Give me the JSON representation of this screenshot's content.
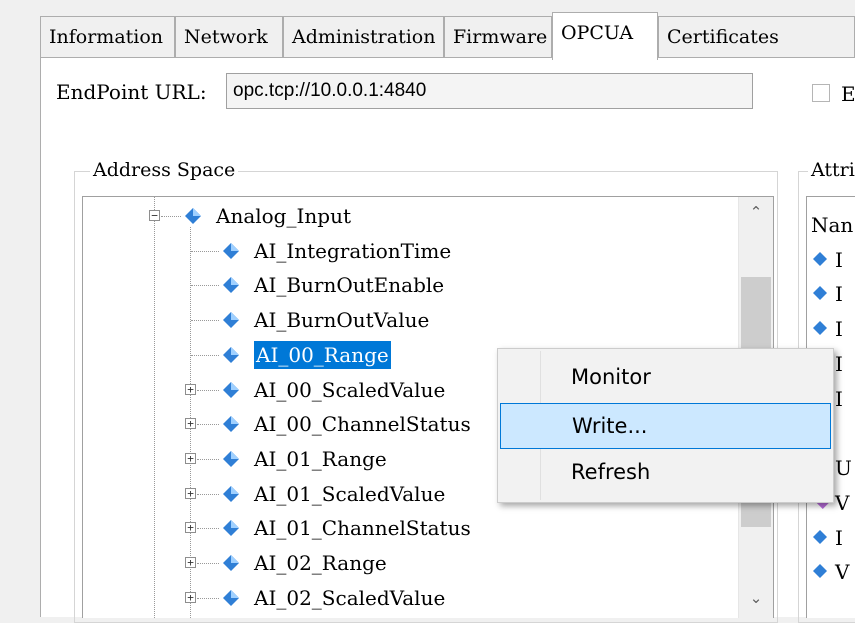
{
  "tabs": [
    {
      "label": "Information",
      "active": false
    },
    {
      "label": "Network",
      "active": false
    },
    {
      "label": "Administration",
      "active": false
    },
    {
      "label": "Firmware",
      "active": false
    },
    {
      "label": "OPCUA",
      "active": true
    },
    {
      "label": "Certificates",
      "active": false
    }
  ],
  "endpoint": {
    "label": "EndPoint URL:",
    "value": "opc.tcp://10.0.0.1:4840"
  },
  "enable_checkbox": {
    "label": "En",
    "checked": false
  },
  "address_space": {
    "title": "Address Space",
    "nodes": [
      {
        "label": "Analog_Input",
        "expander": "−",
        "icon": "variable-icon"
      },
      {
        "label": "AI_IntegrationTime",
        "expander": "",
        "icon": "variable-icon"
      },
      {
        "label": "AI_BurnOutEnable",
        "expander": "",
        "icon": "variable-icon"
      },
      {
        "label": "AI_BurnOutValue",
        "expander": "",
        "icon": "variable-icon"
      },
      {
        "label": "AI_00_Range",
        "expander": "",
        "icon": "variable-icon",
        "selected": true
      },
      {
        "label": "AI_00_ScaledValue",
        "expander": "+",
        "icon": "variable-icon"
      },
      {
        "label": "AI_00_ChannelStatus",
        "expander": "+",
        "icon": "variable-icon"
      },
      {
        "label": "AI_01_Range",
        "expander": "+",
        "icon": "variable-icon"
      },
      {
        "label": "AI_01_ScaledValue",
        "expander": "+",
        "icon": "variable-icon"
      },
      {
        "label": "AI_01_ChannelStatus",
        "expander": "+",
        "icon": "variable-icon"
      },
      {
        "label": "AI_02_Range",
        "expander": "+",
        "icon": "variable-icon"
      },
      {
        "label": "AI_02_ScaledValue",
        "expander": "+",
        "icon": "variable-icon"
      }
    ],
    "scroll_up": "⌃",
    "scroll_down": "⌄"
  },
  "attributes": {
    "title": "Attri",
    "rows": [
      {
        "text": "Nan",
        "icon": ""
      },
      {
        "text": "I",
        "icon": "variable-icon"
      },
      {
        "text": "I",
        "icon": "variable-icon"
      },
      {
        "text": "I",
        "icon": "variable-icon"
      },
      {
        "text": "I",
        "icon": ""
      },
      {
        "text": "I",
        "icon": ""
      },
      {
        "text": "",
        "icon": ""
      },
      {
        "text": "U",
        "icon": ""
      },
      {
        "text": "V",
        "icon": "value-icon"
      },
      {
        "text": "I",
        "icon": "variable-icon"
      },
      {
        "text": "V",
        "icon": "variable-icon"
      }
    ]
  },
  "context_menu": {
    "items": [
      {
        "label": "Monitor",
        "highlighted": false
      },
      {
        "label": "Write...",
        "highlighted": true
      },
      {
        "label": "Refresh",
        "highlighted": false
      }
    ]
  },
  "colors": {
    "selection": "#0078d7",
    "menu_highlight": "#cce8ff",
    "icon_blue": "#2f7fd6"
  }
}
